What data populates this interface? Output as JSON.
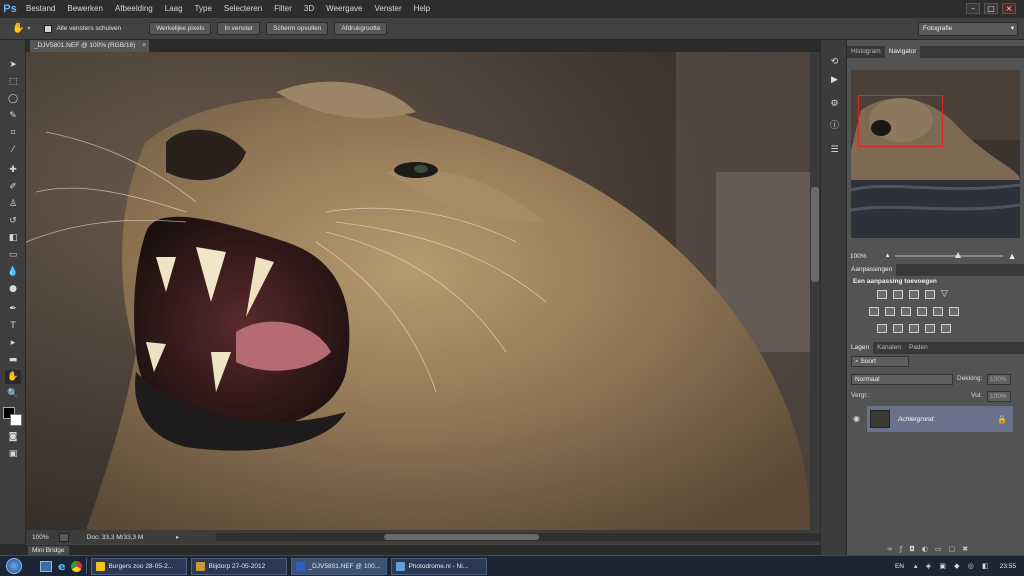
{
  "app": {
    "logo": "Ps"
  },
  "menu": [
    "Bestand",
    "Bewerken",
    "Afbeelding",
    "Laag",
    "Type",
    "Selecteren",
    "Filter",
    "3D",
    "Weergave",
    "Venster",
    "Help"
  ],
  "window_controls": {
    "minimize": "–",
    "maximize": "□",
    "close": "×"
  },
  "options_bar": {
    "checkbox_label": "Alle vensters schuiven",
    "buttons": [
      "Werkelijke pixels",
      "In venster",
      "Scherm opvullen",
      "Afdrukgrootte"
    ],
    "workspace": "Fotografie"
  },
  "document": {
    "tab_title": "_DJV5801.NEF @ 100% (RGB/16)",
    "close": "×"
  },
  "status": {
    "zoom": "100%",
    "doc_info": "Doc: 33,3 M/33,3 M"
  },
  "mini_bridge": {
    "label": "Mini Bridge"
  },
  "navigator_panel": {
    "tabs": [
      "Histogram",
      "Navigator"
    ],
    "active_tab": "Navigator",
    "zoom": "100%"
  },
  "adjustments_panel": {
    "tab": "Aanpassingen",
    "subtitle": "Een aanpassing toevoegen"
  },
  "layers_panel": {
    "tabs": [
      "Lagen",
      "Kanalen",
      "Paden"
    ],
    "kind_filter": "Soort",
    "blend_mode": "Normaal",
    "opacity_label": "Dekking:",
    "opacity_value": "100%",
    "lock_label": "Vergr.:",
    "fill_label": "Vul:",
    "fill_value": "100%",
    "layers": [
      {
        "name": "Achtergrond",
        "visible": true,
        "locked": true
      }
    ]
  },
  "taskbar": {
    "items": [
      {
        "label": "Burgers zoo 28-05-2...",
        "color": "#f0c419"
      },
      {
        "label": "Blijdorp 27-05-2012",
        "color": "#c99a2e"
      },
      {
        "label": "_DJV5801.NEF @ 100...",
        "color": "#2e5fbf"
      },
      {
        "label": "Photodrome.nl - Ni...",
        "color": "#5fa0e0"
      }
    ],
    "language": "EN",
    "clock": "23:55"
  },
  "colors": {
    "accent": "#6ab0ff",
    "selection": "#69728a",
    "nav_rect": "#e02424"
  }
}
